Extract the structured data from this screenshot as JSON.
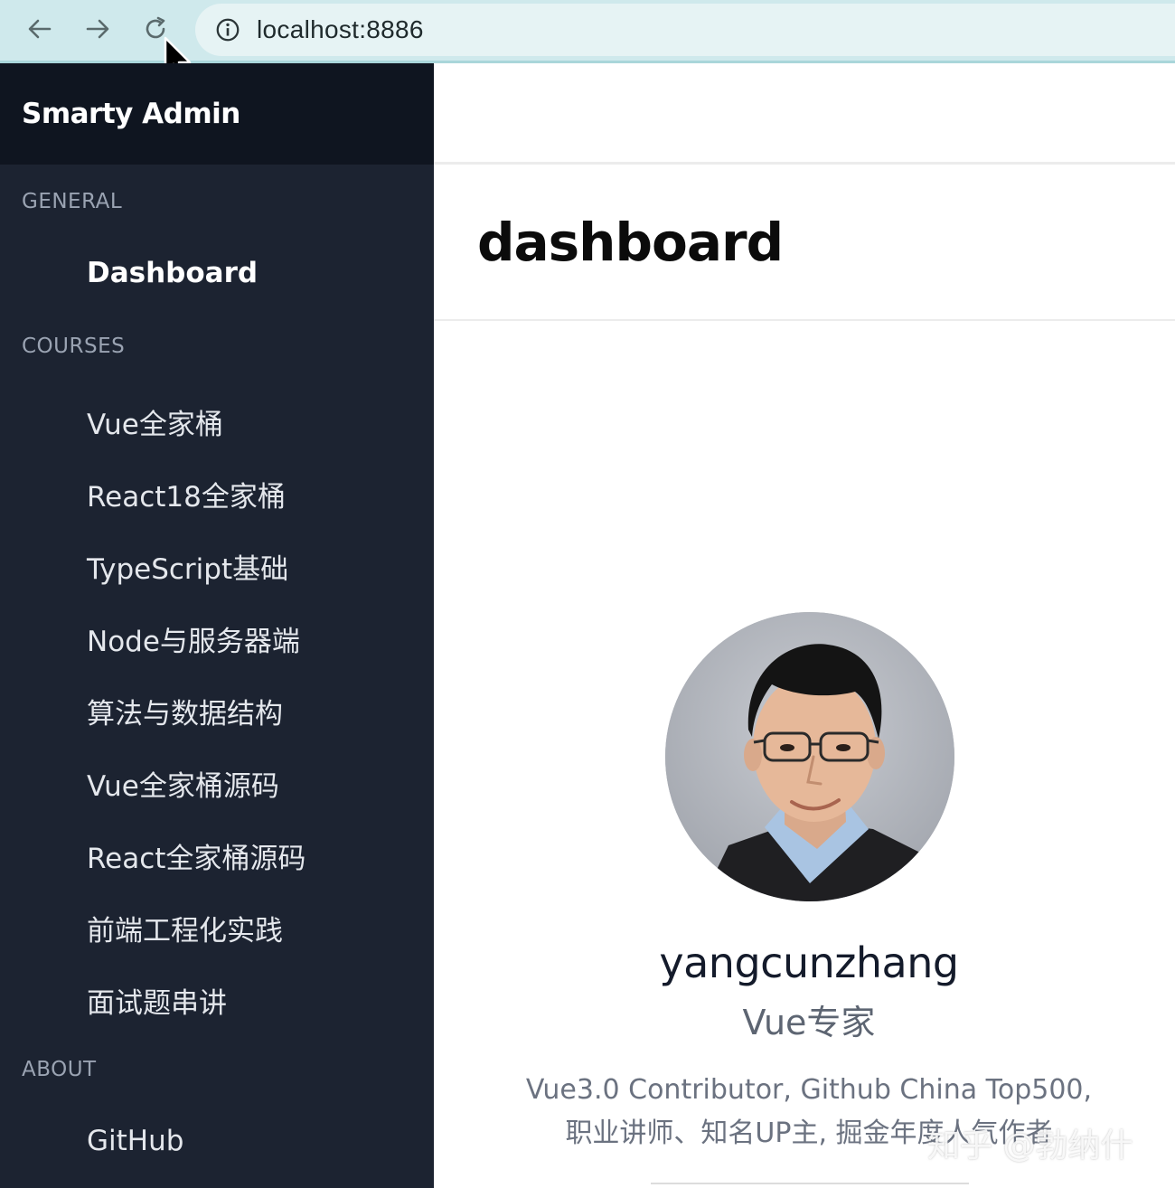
{
  "browser": {
    "url": "localhost:8886"
  },
  "sidebar": {
    "brand": "Smarty Admin",
    "sections": [
      {
        "label": "GENERAL",
        "items": [
          {
            "label": "Dashboard",
            "active": true
          }
        ]
      },
      {
        "label": "COURSES",
        "items": [
          {
            "label": "Vue全家桶"
          },
          {
            "label": "React18全家桶"
          },
          {
            "label": "TypeScript基础"
          },
          {
            "label": "Node与服务器端"
          },
          {
            "label": "算法与数据结构"
          },
          {
            "label": "Vue全家桶源码"
          },
          {
            "label": "React全家桶源码"
          },
          {
            "label": "前端工程化实践"
          },
          {
            "label": "面试题串讲"
          }
        ]
      },
      {
        "label": "ABOUT",
        "items": [
          {
            "label": "GitHub"
          }
        ]
      }
    ]
  },
  "main": {
    "title": "dashboard",
    "profile": {
      "name": "yangcunzhang",
      "role": "Vue专家",
      "bio": "Vue3.0 Contributor, Github China Top500, 职业讲师、知名UP主, 掘金年度人气作者"
    }
  },
  "watermark": "知乎 @勃纳什"
}
